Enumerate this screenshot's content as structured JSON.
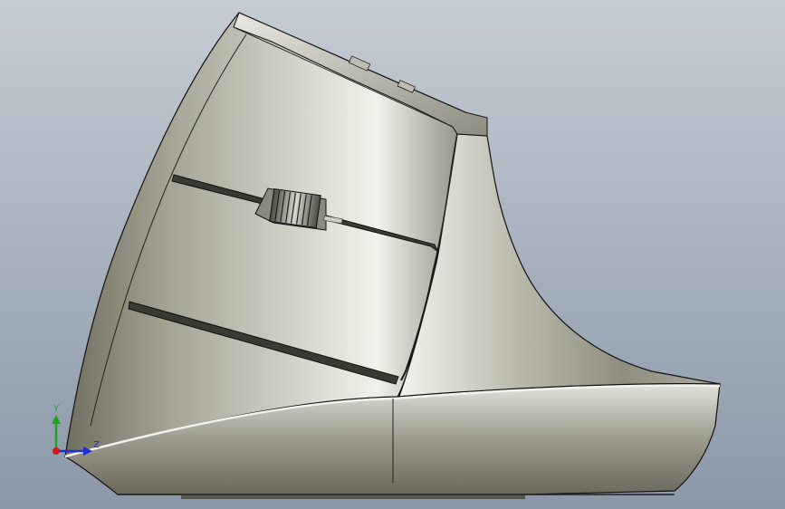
{
  "viewport": {
    "background_top": "#c5ccd4",
    "background_bottom": "#8b98a8"
  },
  "model": {
    "body_color_light": "#e6e6de",
    "body_color_dark": "#5e5d50",
    "edge_color": "#111111"
  },
  "triad": {
    "y_label": "Y",
    "z_label": "Z",
    "y_color": "#1fa31f",
    "z_color": "#1e2fd6",
    "x_color": "#d21a1a"
  }
}
